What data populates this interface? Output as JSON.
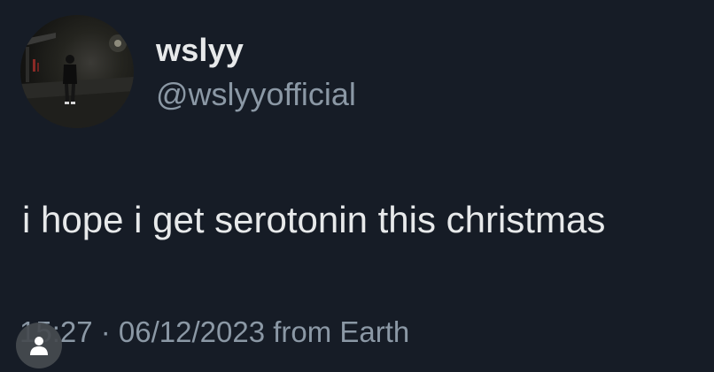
{
  "tweet": {
    "author": {
      "display_name": "wslyy",
      "handle": "@wslyyofficial",
      "avatar_icon": "profile-photo"
    },
    "text": "i hope i get serotonin this christmas",
    "meta": "15:27 · 06/12/2023 from Earth"
  },
  "overlay": {
    "icon": "person-icon"
  },
  "colors": {
    "background": "#161c26",
    "primary_text": "#e7e9ea",
    "secondary_text": "#8b98a5"
  }
}
